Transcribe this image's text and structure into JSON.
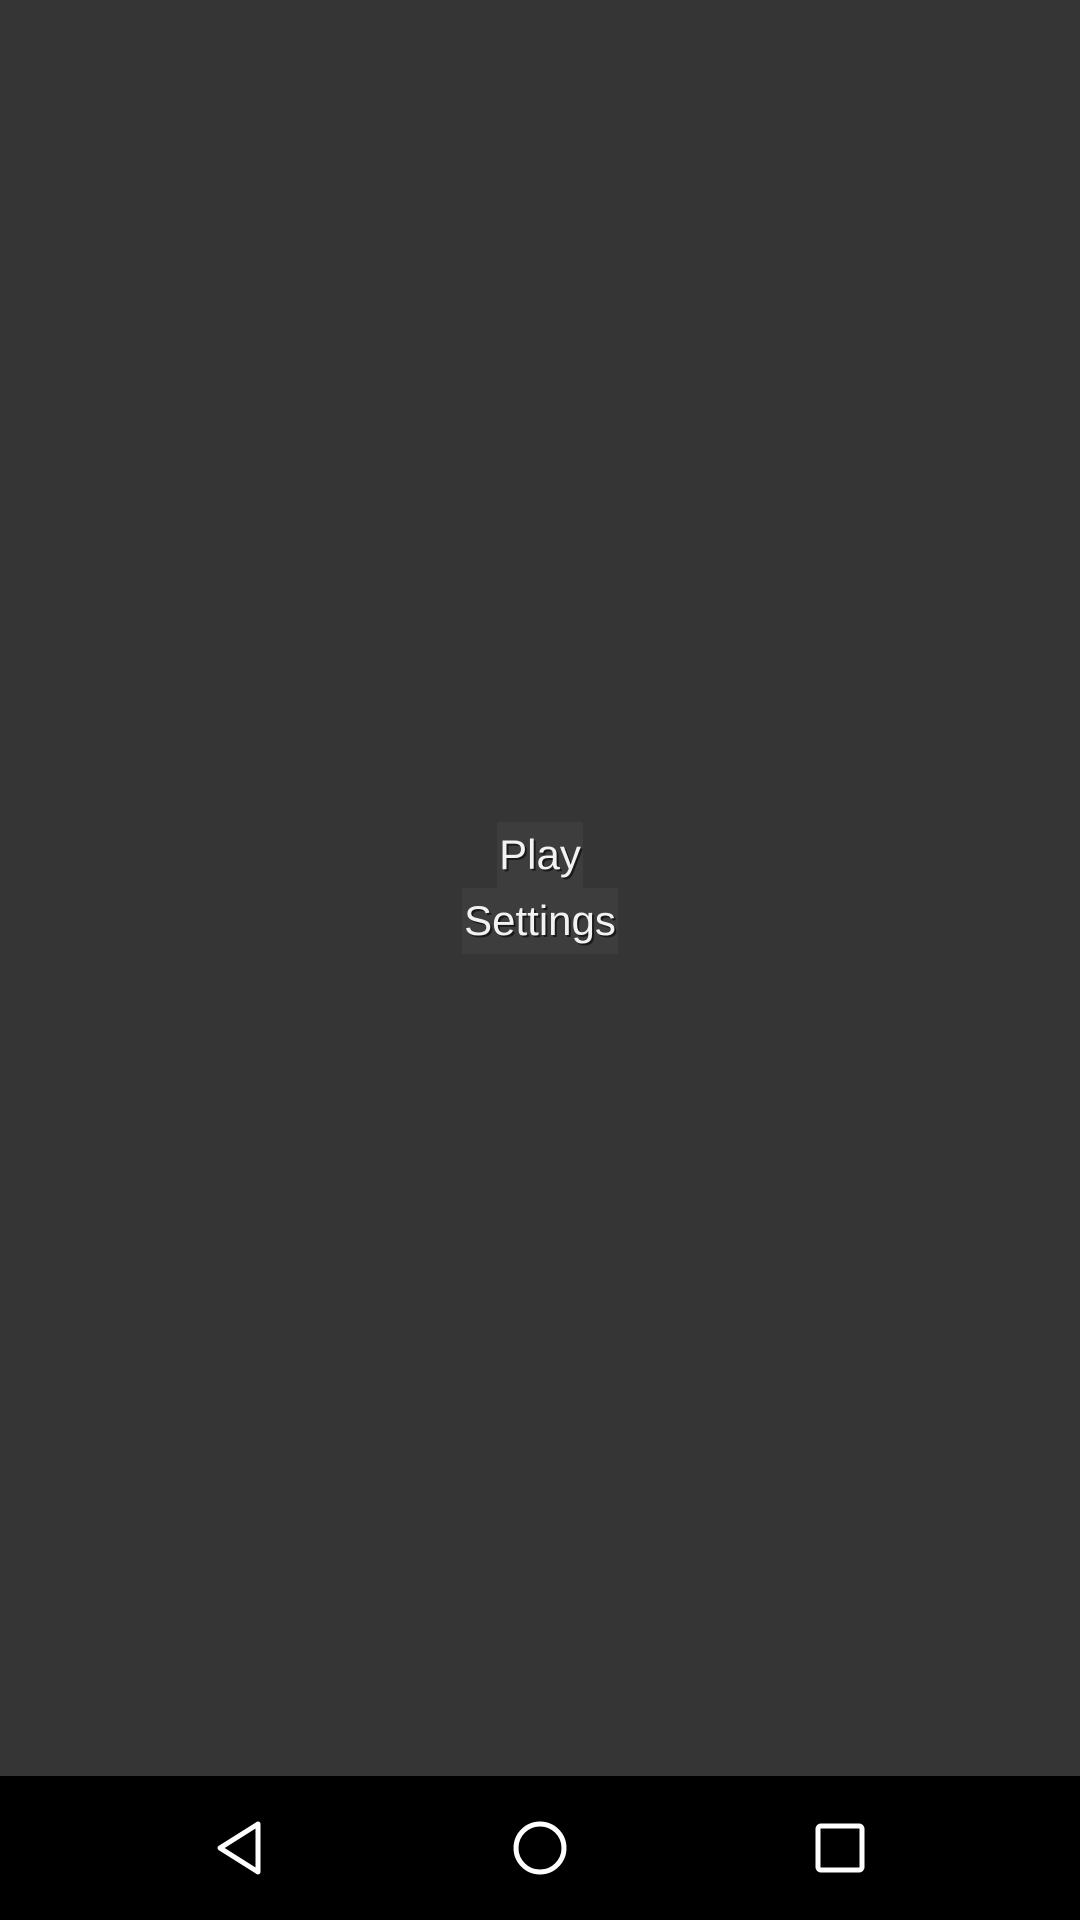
{
  "menu": {
    "play_label": "Play",
    "settings_label": "Settings"
  },
  "navigation_bar": {
    "buttons": [
      "back-icon",
      "home-icon",
      "recents-icon"
    ],
    "icon_color": "#ffffff",
    "background_color": "#000000"
  },
  "colors": {
    "app_background": "#353535",
    "button_background": "#3d3d3d",
    "button_text": "#f2f2f2"
  }
}
